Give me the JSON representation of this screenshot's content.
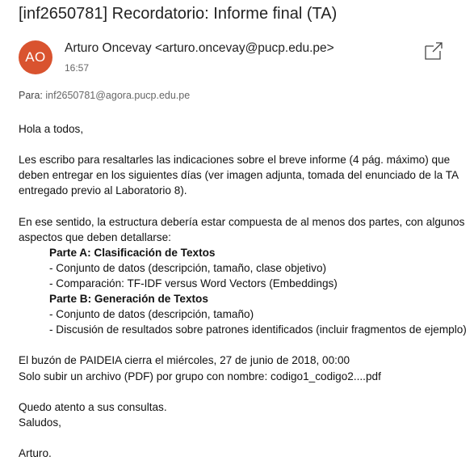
{
  "email": {
    "subject": "[inf2650781] Recordatorio: Informe final (TA)",
    "avatar_initials": "AO",
    "avatar_color": "#d9532f",
    "sender": "Arturo Oncevay <arturo.oncevay@pucp.edu.pe>",
    "time": "16:57",
    "to_label": "Para:",
    "to_address": "inf2650781@agora.pucp.edu.pe",
    "popout_icon": "popout-window-icon",
    "body": {
      "greeting": "Hola a todos,",
      "p1_l1": "Les escribo para resaltarles las indicaciones sobre el breve informe (4 pág. máximo) que",
      "p1_l2": "deben entregar en los siguientes días (ver imagen adjunta, tomada del enunciado de la TA",
      "p1_l3": "entregado previo al Laboratorio 8).",
      "p2_l1": "En ese sentido, la estructura debería estar compuesta de al menos dos partes, con algunos",
      "p2_l2": "aspectos que deben detallarse:",
      "partA_title": "Parte A: Clasificación de Textos",
      "partA_item1": "- Conjunto de datos (descripción, tamaño, clase objetivo)",
      "partA_item2": "- Comparación: TF-IDF versus Word Vectors (Embeddings)",
      "partB_title": "Parte B: Generación de Textos",
      "partB_item1": "- Conjunto de datos (descripción, tamaño)",
      "partB_item2": "- Discusión de resultados sobre patrones identificados (incluir fragmentos de ejemplo)",
      "p3_l1": "El buzón de PAIDEIA cierra el miércoles, 27 de junio de 2018, 00:00",
      "p3_l2": "Solo subir un archivo (PDF) por grupo con nombre: codigo1_codigo2....pdf",
      "closing1": "Quedo atento a sus consultas.",
      "closing2": "Saludos,",
      "signature": "Arturo."
    }
  }
}
